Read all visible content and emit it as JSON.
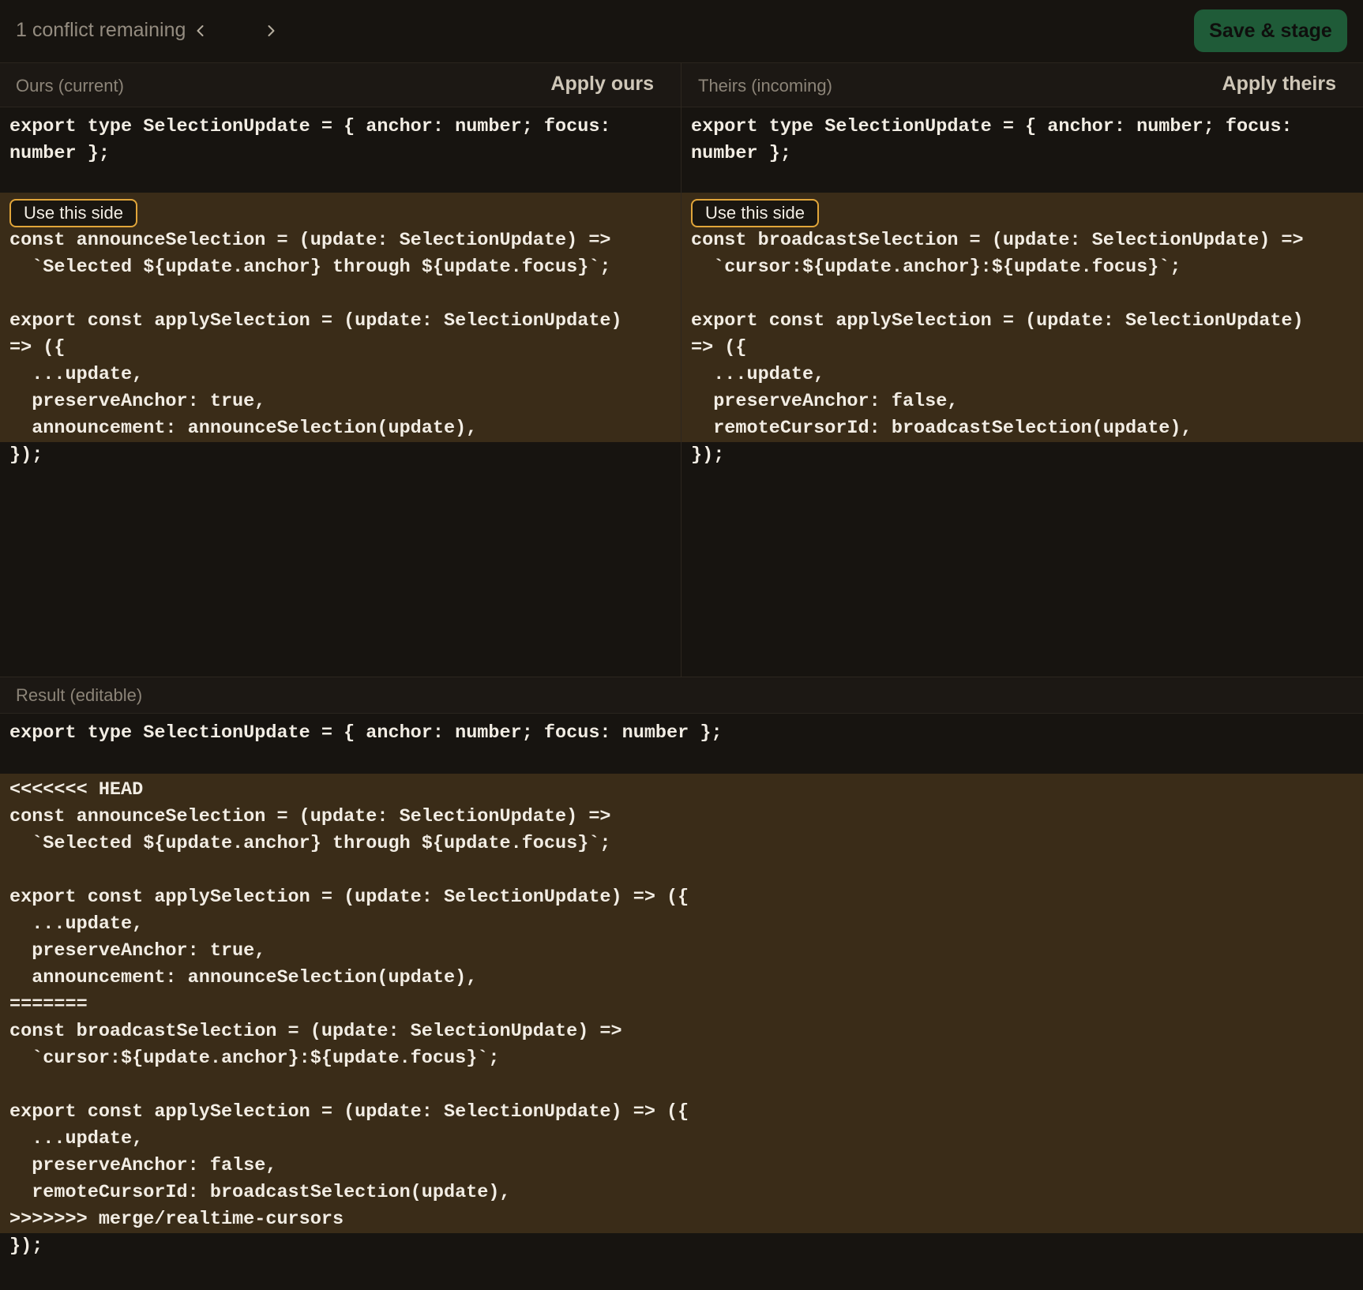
{
  "toolbar": {
    "conflict_status": "1 conflict remaining",
    "prev_icon": "chevron-left-icon",
    "next_icon": "chevron-right-icon",
    "save_label": "Save & stage",
    "save_color": "#1f5b38"
  },
  "ours": {
    "title": "Ours (current)",
    "apply_label": "Apply ours",
    "common_code": "export type SelectionUpdate = { anchor: number; focus:\nnumber };",
    "use_side_label": "Use this side",
    "conflict_code": "const announceSelection = (update: SelectionUpdate) =>\n  `Selected ${update.anchor} through ${update.focus}`;\n\nexport const applySelection = (update: SelectionUpdate)\n=> ({\n  ...update,\n  preserveAnchor: true,\n  announcement: announceSelection(update),",
    "after_code": "});"
  },
  "theirs": {
    "title": "Theirs (incoming)",
    "apply_label": "Apply theirs",
    "common_code": "export type SelectionUpdate = { anchor: number; focus:\nnumber };",
    "use_side_label": "Use this side",
    "conflict_code": "const broadcastSelection = (update: SelectionUpdate) =>\n  `cursor:${update.anchor}:${update.focus}`;\n\nexport const applySelection = (update: SelectionUpdate)\n=> ({\n  ...update,\n  preserveAnchor: false,\n  remoteCursorId: broadcastSelection(update),",
    "after_code": "});"
  },
  "result": {
    "title": "Result (editable)",
    "common_code": "export type SelectionUpdate = { anchor: number; focus: number };",
    "conflict_code": "<<<<<<< HEAD\nconst announceSelection = (update: SelectionUpdate) =>\n  `Selected ${update.anchor} through ${update.focus}`;\n\nexport const applySelection = (update: SelectionUpdate) => ({\n  ...update,\n  preserveAnchor: true,\n  announcement: announceSelection(update),\n=======\nconst broadcastSelection = (update: SelectionUpdate) =>\n  `cursor:${update.anchor}:${update.focus}`;\n\nexport const applySelection = (update: SelectionUpdate) => ({\n  ...update,\n  preserveAnchor: false,\n  remoteCursorId: broadcastSelection(update),\n>>>>>>> merge/realtime-cursors",
    "after_code": "});"
  },
  "colors": {
    "background": "#171410",
    "conflict_highlight": "#3a2c18",
    "use_side_border": "#e0a53a"
  }
}
